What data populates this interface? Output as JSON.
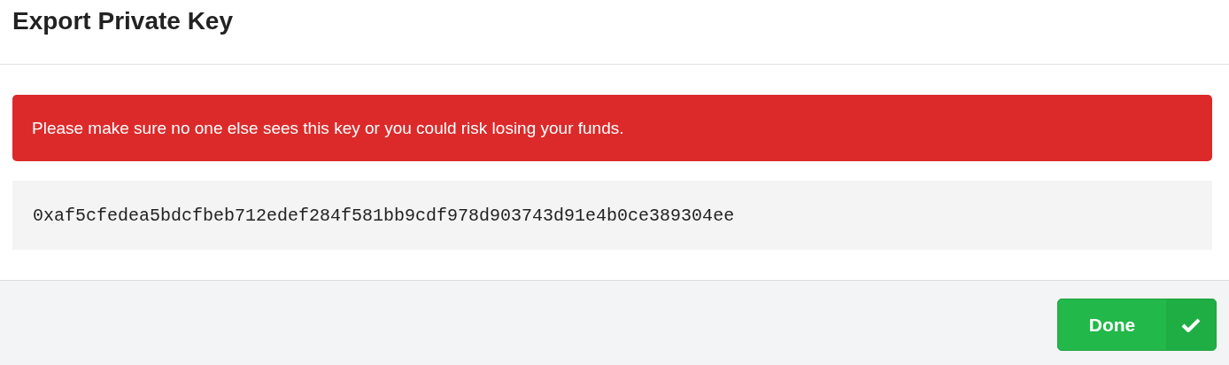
{
  "dialog": {
    "title": "Export Private Key"
  },
  "alert": {
    "message": "Please make sure no one else sees this key or you could risk losing your funds."
  },
  "private_key": "0xaf5cfedea5bdcfbeb712edef284f581bb9cdf978d903743d91e4b0ce389304ee",
  "footer": {
    "buttons": [
      {
        "label": "Done"
      }
    ]
  }
}
